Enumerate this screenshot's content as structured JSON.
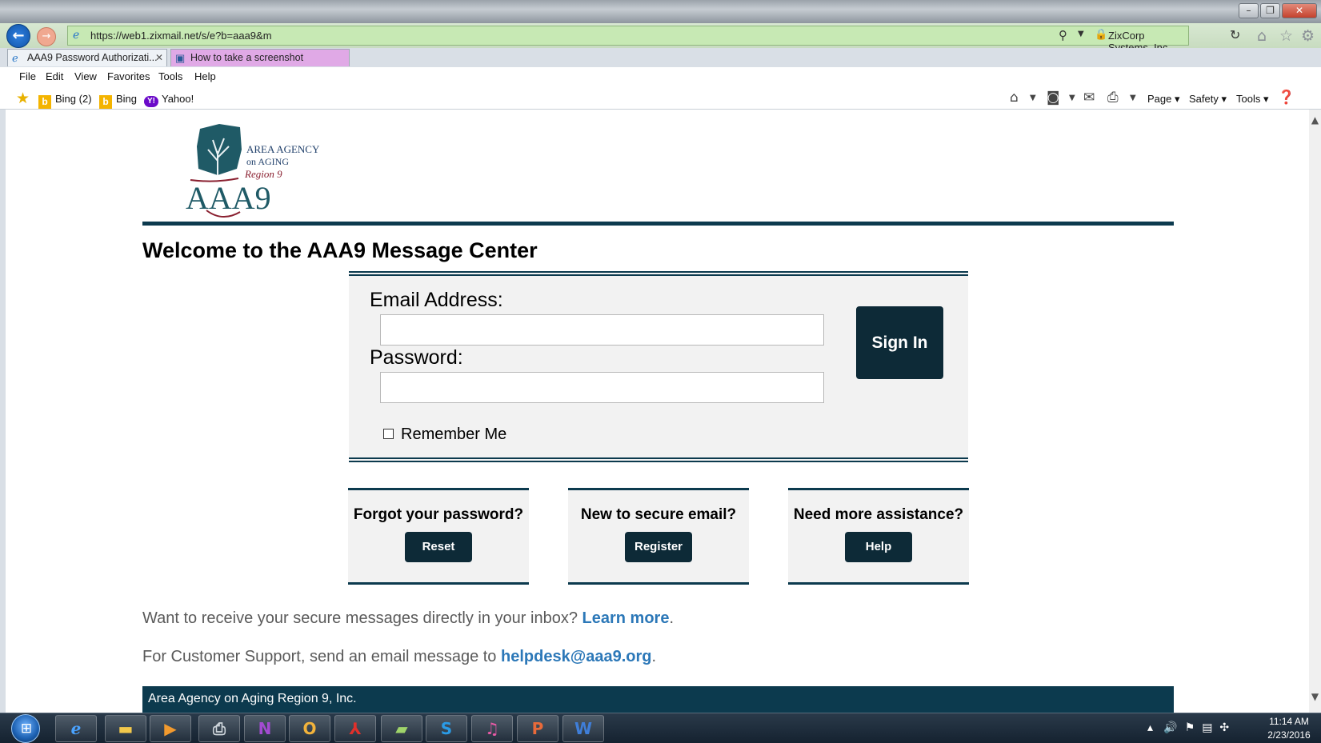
{
  "browser": {
    "url": "https://web1.zixmail.net/s/e?b=aaa9&m",
    "cert": "ZixCorp Systems, Inc. [US]",
    "tabs": [
      {
        "label": "AAA9 Password Authorizati..."
      },
      {
        "label": "How to take a screenshot"
      }
    ],
    "menu": [
      "File",
      "Edit",
      "View",
      "Favorites",
      "Tools",
      "Help"
    ],
    "favorites": [
      "Bing (2)",
      "Bing",
      "Yahoo!"
    ],
    "commands": [
      "Page",
      "Safety",
      "Tools"
    ]
  },
  "logo": {
    "line1": "AREA AGENCY",
    "line2": "on AGING",
    "line3": "Region 9",
    "mark": "AAA9"
  },
  "page": {
    "welcome": "Welcome to the AAA9 Message Center",
    "email_label": "Email Address:",
    "password_label": "Password:",
    "signin": "Sign In",
    "remember": "Remember Me",
    "assist": [
      {
        "question": "Forgot your password?",
        "button": "Reset"
      },
      {
        "question": "New to secure email?",
        "button": "Register"
      },
      {
        "question": "Need more assistance?",
        "button": "Help"
      }
    ],
    "inbox_text": "Want to receive your secure messages directly in your inbox?",
    "inbox_link": "Learn more",
    "support_text": "For Customer Support, send an email message to",
    "support_link": "helpdesk@aaa9.org",
    "footer": "Area Agency on Aging Region 9, Inc."
  },
  "taskbar": {
    "time": "11:14 AM",
    "date": "2/23/2016"
  },
  "colors": {
    "brand_dark": "#0c3a4e",
    "button": "#0d2a37",
    "link": "#2c78b8",
    "address_bar": "#c7e9b4"
  }
}
